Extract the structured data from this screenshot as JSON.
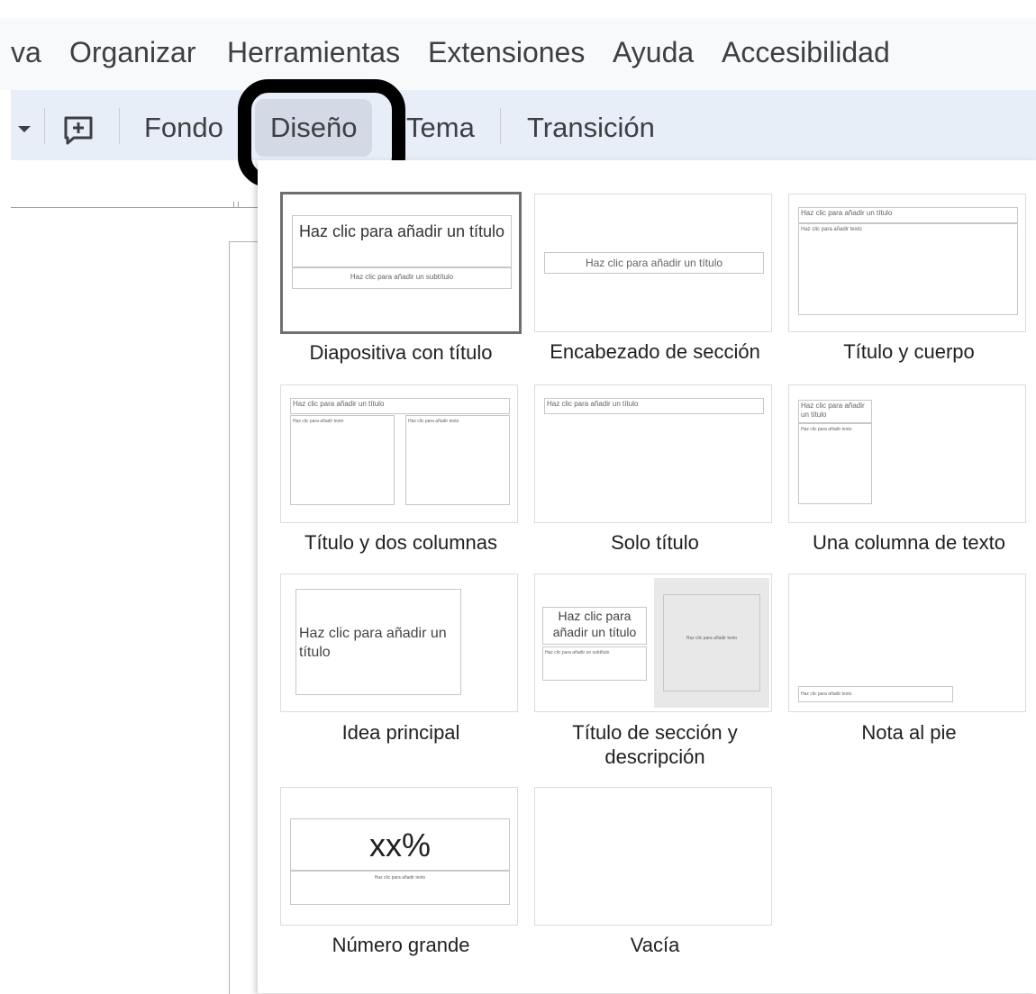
{
  "menubar": {
    "items": [
      "va",
      "Organizar",
      "Herramientas",
      "Extensiones",
      "Ayuda",
      "Accesibilidad"
    ]
  },
  "toolbar": {
    "fondo": "Fondo",
    "disenio": "Diseño",
    "tema": "Tema",
    "transicion": "Transición"
  },
  "layouts": [
    {
      "label": "Diapositiva con título",
      "title_placeholder": "Haz clic para añadir un título",
      "subtitle_placeholder": "Haz clic para añadir un subtítulo"
    },
    {
      "label": "Encabezado de sección",
      "title_placeholder": "Haz clic para añadir un título"
    },
    {
      "label": "Título y cuerpo",
      "title_placeholder": "Haz clic para añadir un título",
      "body_placeholder": "Haz clic para añadir texto"
    },
    {
      "label": "Título y dos columnas",
      "title_placeholder": "Haz clic para añadir un título",
      "col1_placeholder": "Haz clic para añadir texto",
      "col2_placeholder": "Haz clic para añadir texto"
    },
    {
      "label": "Solo título",
      "title_placeholder": "Haz clic para añadir un título"
    },
    {
      "label": "Una columna de texto",
      "title_placeholder": "Haz clic para añadir un título",
      "body_placeholder": "Haz clic para añadir texto"
    },
    {
      "label": "Idea principal",
      "title_placeholder": "Haz clic para añadir un título"
    },
    {
      "label_line1": "Título de sección y",
      "label_line2": "descripción",
      "title_placeholder": "Haz clic para añadir un título",
      "subtitle_placeholder": "Haz clic para añadir un subtítulo",
      "body_placeholder": "Haz clic para añadir texto"
    },
    {
      "label": "Nota al pie",
      "body_placeholder": "Haz clic para añadir texto"
    },
    {
      "label": "Número grande",
      "number": "xx%",
      "body_placeholder": "Haz clic para añadir texto"
    },
    {
      "label": "Vacía"
    }
  ]
}
